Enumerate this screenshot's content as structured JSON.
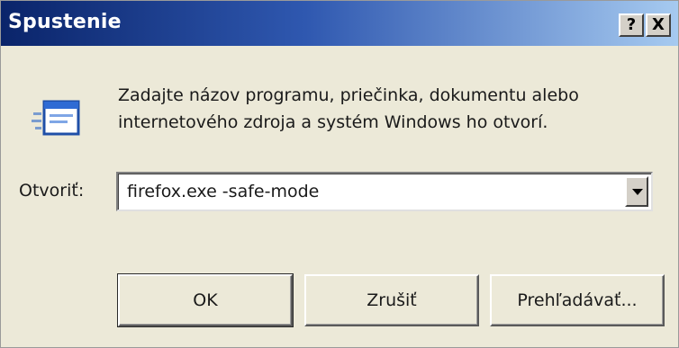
{
  "window": {
    "title": "Spustenie",
    "help_label": "?",
    "close_label": "X"
  },
  "prompt": {
    "line1": "Zadajte názov programu, priečinka, dokumentu alebo",
    "line2": "internetového zdroja a systém Windows ho otvorí."
  },
  "open_field": {
    "label": "Otvoriť:",
    "value": "firefox.exe -safe-mode"
  },
  "buttons": {
    "ok": "OK",
    "cancel": "Zrušiť",
    "browse": "Prehľadávať..."
  },
  "icons": {
    "run": "run-program-icon",
    "dropdown": "chevron-down-icon"
  },
  "colors": {
    "titlebar_start": "#0a246a",
    "titlebar_end": "#a6caf0",
    "dialog_bg": "#ece9d8"
  }
}
